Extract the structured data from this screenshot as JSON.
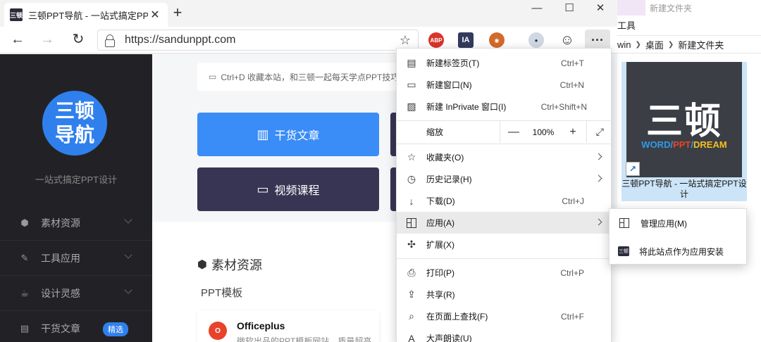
{
  "browser": {
    "tab_title": "三顿PPT导航 - 一站式搞定PPT设",
    "tab_favicon": "三顿",
    "new_tab": "+",
    "close_tab": "✕",
    "url": "https://sandunppt.com",
    "window": {
      "minimize": "—",
      "maximize": "☐",
      "close": "✕"
    },
    "extensions": {
      "abp": "ABP",
      "ia": "IA",
      "more": "···"
    }
  },
  "site": {
    "logo_line1": "三顿",
    "logo_line2": "导航",
    "tagline": "一站式搞定PPT设计",
    "sidebar": [
      {
        "label": "素材资源",
        "icon": "⬢"
      },
      {
        "label": "工具应用",
        "icon": "✎"
      },
      {
        "label": "设计灵感",
        "icon": "☕"
      },
      {
        "label": "干货文章",
        "icon": "▤",
        "badge": "精选"
      }
    ],
    "tip": "Ctrl+D 收藏本站，和三顿一起每天学点PPT技巧",
    "buttons": {
      "articles": "干货文章",
      "videos": "视频课程"
    },
    "section_title": "素材资源",
    "section_sub": "PPT模板",
    "card": {
      "title": "Officeplus",
      "desc": "微软出品的PPT模板网站，质量超高",
      "logo": "O"
    }
  },
  "desktop": {
    "crumb_top": "新建文件夹",
    "tools": "工具",
    "path": [
      "win",
      "桌面",
      "新建文件夹"
    ],
    "thumb_big": "三顿",
    "thumb_word": "WORD",
    "thumb_ppt": "PPT",
    "thumb_dream": "DREAM",
    "slash": "/",
    "icon_label": "三顿PPT导航 - 一站式搞定PPT设计"
  },
  "menu": {
    "items": [
      {
        "label": "新建标签页(T)",
        "shortcut": "Ctrl+T"
      },
      {
        "label": "新建窗口(N)",
        "shortcut": "Ctrl+N"
      },
      {
        "label": "新建 InPrivate 窗口(I)",
        "shortcut": "Ctrl+Shift+N"
      },
      {
        "label": "缩放"
      },
      {
        "label": "收藏夹(O)"
      },
      {
        "label": "历史记录(H)"
      },
      {
        "label": "下载(D)",
        "shortcut": "Ctrl+J"
      },
      {
        "label": "应用(A)"
      },
      {
        "label": "扩展(X)"
      },
      {
        "label": "打印(P)",
        "shortcut": "Ctrl+P"
      },
      {
        "label": "共享(R)"
      },
      {
        "label": "在页面上查找(F)",
        "shortcut": "Ctrl+F"
      },
      {
        "label": "大声朗读(U)"
      }
    ],
    "zoom": {
      "minus": "—",
      "value": "100%",
      "plus": "+",
      "full": "⤢"
    },
    "submenu": [
      {
        "label": "管理应用(M)"
      },
      {
        "label": "将此站点作为应用安装"
      }
    ]
  }
}
